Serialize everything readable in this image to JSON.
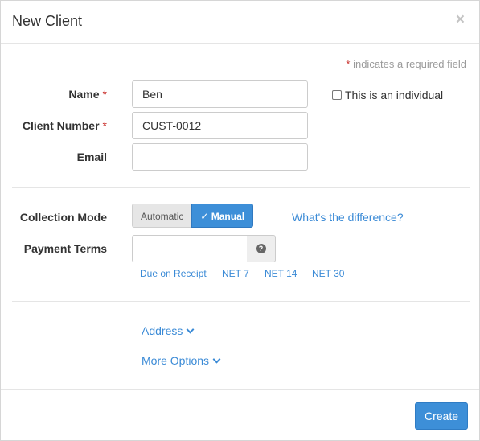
{
  "header": {
    "title": "New Client",
    "close_glyph": "×"
  },
  "required_note": {
    "star": "*",
    "text": " indicates a required field"
  },
  "fields": {
    "name": {
      "label": "Name",
      "required_star": "*",
      "value": "Ben"
    },
    "client_number": {
      "label": "Client Number",
      "required_star": "*",
      "value": "CUST-0012"
    },
    "email": {
      "label": "Email",
      "value": ""
    }
  },
  "individual_checkbox": {
    "label": "This is an individual",
    "checked": false
  },
  "collection_mode": {
    "label": "Collection Mode",
    "options": [
      "Automatic",
      "✓ Manual"
    ],
    "selected": "Manual",
    "help_link": "What's the difference?"
  },
  "payment_terms": {
    "label": "Payment Terms",
    "value": "",
    "help_icon": "question-circle-icon",
    "help_glyph": "?",
    "presets": [
      "Due on Receipt",
      "NET 7",
      "NET 14",
      "NET 30"
    ]
  },
  "expanders": {
    "address": "Address",
    "more_options": "More Options"
  },
  "footer": {
    "create_label": "Create"
  },
  "colors": {
    "accent": "#3d8fd8",
    "link": "#3a8ad6",
    "required": "#c9302c"
  }
}
